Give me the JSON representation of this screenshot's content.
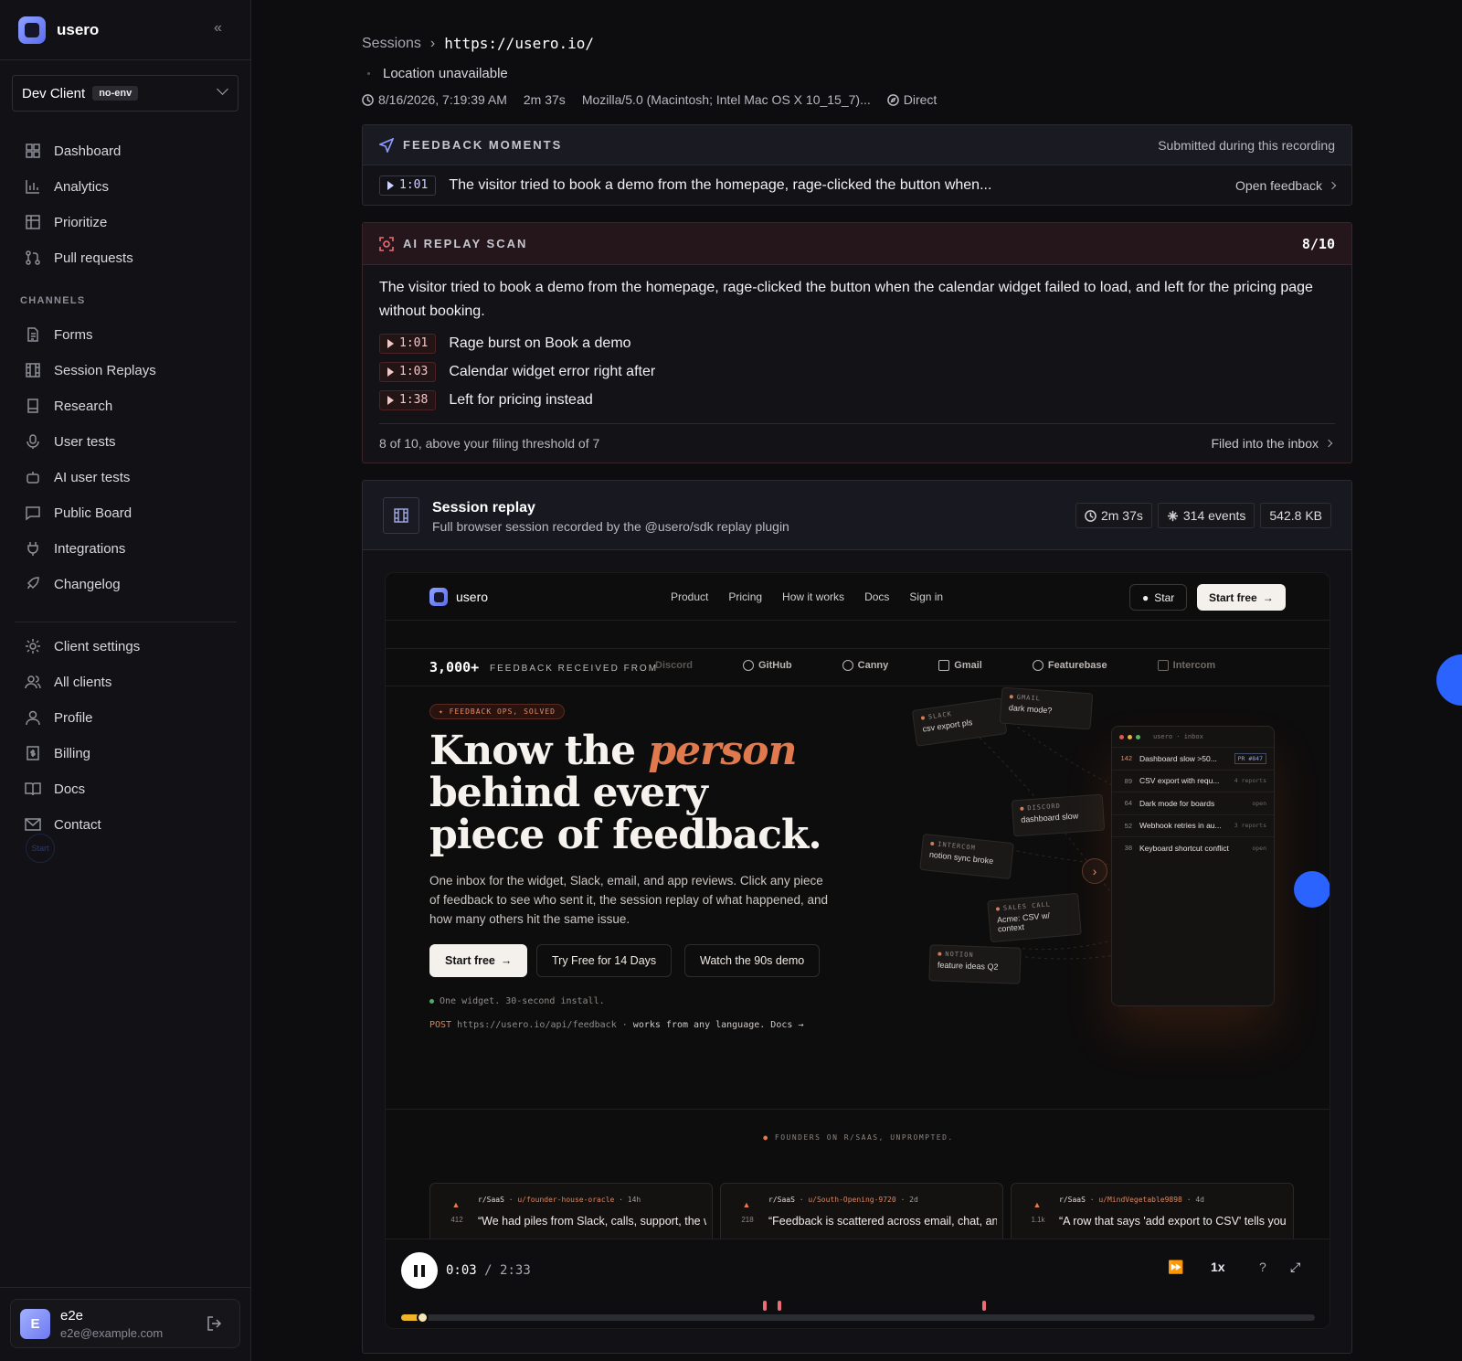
{
  "app": {
    "name": "usero"
  },
  "client": {
    "name": "Dev Client",
    "env": "no-env"
  },
  "nav_primary": [
    "Dashboard",
    "Analytics",
    "Prioritize",
    "Pull requests"
  ],
  "channels_heading": "CHANNELS",
  "nav_channels": [
    "Forms",
    "Session Replays",
    "Research",
    "User tests",
    "AI user tests",
    "Public Board",
    "Integrations",
    "Changelog"
  ],
  "nav_settings": [
    "Client settings",
    "All clients",
    "Profile",
    "Billing",
    "Docs",
    "Contact"
  ],
  "start_label": "Start",
  "user": {
    "initial": "E",
    "name": "e2e",
    "email": "e2e@example.com"
  },
  "breadcrumb": {
    "root": "Sessions",
    "current": "https://usero.io/"
  },
  "session": {
    "location": "Location unavailable",
    "datetime": "8/16/2026, 7:19:39 AM",
    "duration": "2m 37s",
    "user_agent": "Mozilla/5.0 (Macintosh; Intel Mac OS X 10_15_7)...",
    "source": "Direct"
  },
  "feedback_moments": {
    "title": "FEEDBACK MOMENTS",
    "subtitle": "Submitted during this recording",
    "items": [
      {
        "time": "1:01",
        "text": "The visitor tried to book a demo from the homepage, rage-clicked the button when...",
        "action": "Open feedback"
      }
    ]
  },
  "ai_scan": {
    "title": "AI REPLAY SCAN",
    "score": "8/10",
    "summary": "The visitor tried to book a demo from the homepage, rage-clicked the button when the calendar widget failed to load, and left for the pricing page without booking.",
    "moments": [
      {
        "time": "1:01",
        "text": "Rage burst on Book a demo"
      },
      {
        "time": "1:03",
        "text": "Calendar widget error right after"
      },
      {
        "time": "1:38",
        "text": "Left for pricing instead"
      }
    ],
    "footer": "8 of 10, above your filing threshold of 7",
    "action": "Filed into the inbox"
  },
  "replay": {
    "title": "Session replay",
    "subtitle": "Full browser session recorded by the @usero/sdk replay plugin",
    "duration": "2m 37s",
    "events": "314 events",
    "size": "542.8 KB"
  },
  "site": {
    "brand": "usero",
    "links": [
      "Product",
      "Pricing",
      "How it works",
      "Docs",
      "Sign in"
    ],
    "star": "Star",
    "start_free": "Start free",
    "count": "3,000+",
    "received_from": "FEEDBACK RECEIVED FROM",
    "sources": [
      "Discord",
      "GitHub",
      "Canny",
      "Gmail",
      "Featurebase",
      "Intercom"
    ],
    "tag": "✦ FEEDBACK OPS, SOLVED",
    "hero_1": "Know the ",
    "hero_em": "person",
    "hero_2": "behind every",
    "hero_3": "piece of feedback.",
    "sub": "One inbox for the widget, Slack, email, and app reviews. Click any piece of feedback to see who sent it, the session replay of what happened, and how many others hit the same issue.",
    "cta_primary": "Start free",
    "cta_trial": "Try Free for 14 Days",
    "cta_demo": "Watch the 90s demo",
    "install": "One widget. 30-second install.",
    "post_method": "POST",
    "post_url": "https://usero.io/api/feedback",
    "post_note": "works from any language. Docs →",
    "chips": [
      {
        "src": "SLACK",
        "text": "csv export pls"
      },
      {
        "src": "GMAIL",
        "text": "dark mode?"
      },
      {
        "src": "DISCORD",
        "text": "dashboard slow"
      },
      {
        "src": "INTERCOM",
        "text": "notion sync broke"
      },
      {
        "src": "SALES CALL",
        "text": "Acme: CSV w/ context"
      },
      {
        "src": "NOTION",
        "text": "feature ideas Q2"
      }
    ],
    "inbox_title": "usero · inbox",
    "inbox": [
      {
        "n": "142",
        "t": "Dashboard slow >50...",
        "s": "PR #847"
      },
      {
        "n": "89",
        "t": "CSV export with requ...",
        "s": "4 reports"
      },
      {
        "n": "64",
        "t": "Dark mode for boards",
        "s": "open"
      },
      {
        "n": "52",
        "t": "Webhook retries in au...",
        "s": "3 reports"
      },
      {
        "n": "38",
        "t": "Keyboard shortcut conflict",
        "s": "open"
      }
    ],
    "founders": "FOUNDERS ON R/SAAS, UNPROMPTED.",
    "posts": [
      {
        "sub": "r/SaaS",
        "user": "u/founder-house-oracle",
        "age": "14h",
        "votes": "412",
        "quote": "“We had piles from Slack, calls, support, the whole museum.”"
      },
      {
        "sub": "r/SaaS",
        "user": "u/South-Opening-9720",
        "age": "2d",
        "votes": "218",
        "quote": "“Feedback is scattered across email, chat, and tickets. It gets messy fast.”"
      },
      {
        "sub": "r/SaaS",
        "user": "u/MindVegetable9898",
        "age": "4d",
        "votes": "1.1k",
        "quote": "“A row that says 'add export to CSV' tells you nothing about who asked, why they"
      }
    ]
  },
  "player": {
    "current": "0:03",
    "total": "2:33",
    "speed": "1x",
    "help": "?",
    "progress": 0.02
  }
}
